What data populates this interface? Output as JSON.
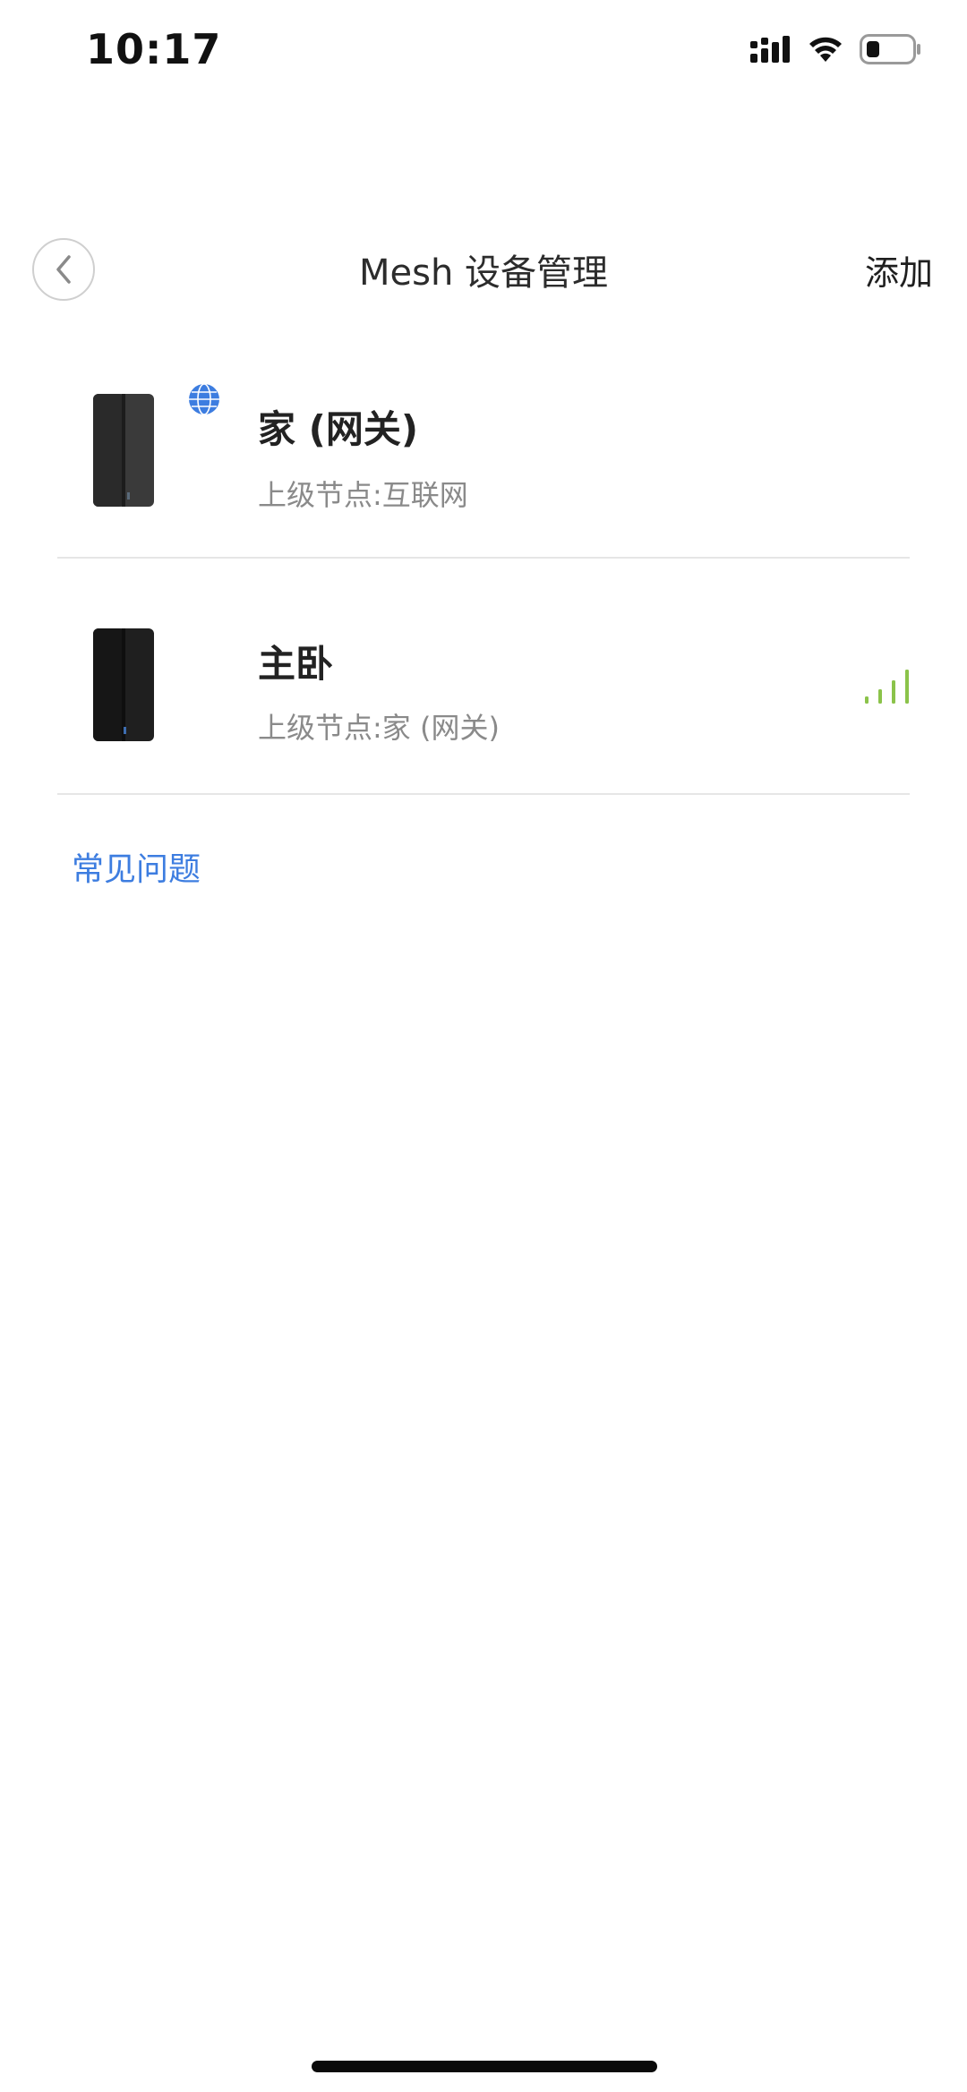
{
  "status_bar": {
    "time": "10:17",
    "icons": [
      "signal-bars-icon",
      "wifi-icon",
      "battery-icon"
    ]
  },
  "nav": {
    "back_icon": "chevron-left-icon",
    "title": "Mesh 设备管理",
    "add_label": "添加"
  },
  "devices": [
    {
      "name": "家 (网关)",
      "parent": "上级节点:互联网",
      "badge_icon": "globe-icon",
      "badge_color": "#3d7de0"
    },
    {
      "name": "主卧",
      "parent": "上级节点:家 (网关)",
      "signal_icon": "signal-strength-icon",
      "signal_color": "#8bc34a"
    }
  ],
  "faq_label": "常见问题",
  "colors": {
    "link": "#3d7de0",
    "signal": "#8bc34a"
  }
}
